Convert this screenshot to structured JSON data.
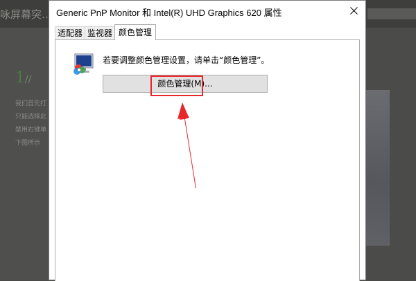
{
  "background_page": {
    "title": "咏屏幕突…",
    "step_number": "1",
    "step_slash": "//",
    "text_lines": [
      "我们首先打",
      "只能选择此",
      "禁用右键单",
      "下图所示"
    ]
  },
  "dialog": {
    "title": "Generic PnP Monitor 和 Intel(R) UHD Graphics 620 属性",
    "tabs": [
      {
        "label": "适配器"
      },
      {
        "label": "监视器"
      },
      {
        "label": "颜色管理"
      }
    ],
    "active_tab": "颜色管理",
    "description": "若要调整颜色管理设置，请单击“颜色管理”。",
    "color_management_button": "颜色管理(M)..."
  },
  "colors": {
    "highlight": "#e8262b",
    "dialog_bg": "#ffffff",
    "button_bg": "#e1e1e1"
  },
  "icons": [
    "close-icon",
    "monitor-color-icon",
    "red-arrow-annotation"
  ]
}
